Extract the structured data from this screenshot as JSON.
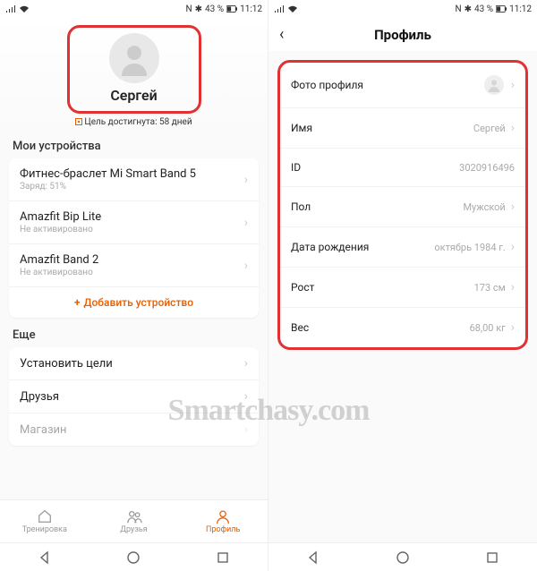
{
  "statusbar": {
    "nfc": "N",
    "bt": "43 %",
    "time": "11:12"
  },
  "left": {
    "username": "Сергей",
    "goal_text": "Цель достигнута: 58 дней",
    "section_devices": "Мои устройства",
    "devices": [
      {
        "name": "Фитнес-браслет Mi Smart Band 5",
        "sub": "Заряд: 51%"
      },
      {
        "name": "Amazfit Bip Lite",
        "sub": "Не активировано"
      },
      {
        "name": "Amazfit Band 2",
        "sub": "Не активировано"
      }
    ],
    "add_device": "Добавить устройство",
    "section_more": "Еще",
    "more": [
      {
        "label": "Установить цели"
      },
      {
        "label": "Друзья"
      },
      {
        "label": "Магазин"
      }
    ],
    "tabs": {
      "workout": "Тренировка",
      "friends": "Друзья",
      "profile": "Профиль"
    }
  },
  "right": {
    "title": "Профиль",
    "rows": {
      "photo": "Фото профиля",
      "name_label": "Имя",
      "name_value": "Сергей",
      "id_label": "ID",
      "id_value": "3020916496",
      "gender_label": "Пол",
      "gender_value": "Мужской",
      "dob_label": "Дата рождения",
      "dob_value": "октябрь 1984 г.",
      "height_label": "Рост",
      "height_value": "173 см",
      "weight_label": "Вес",
      "weight_value": "68,00 кг"
    }
  },
  "watermark": "Smartchasy.com"
}
